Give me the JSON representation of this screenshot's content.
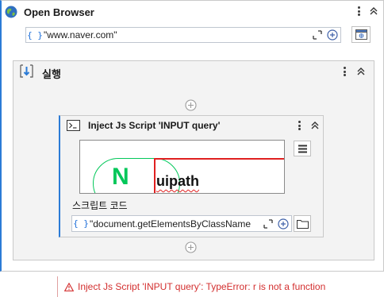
{
  "outer": {
    "title": "Open Browser",
    "url_value": "\"www.naver.com\""
  },
  "sequence": {
    "title": "실행"
  },
  "inject": {
    "title": "Inject Js Script 'INPUT  query'",
    "script_label": "스크립트 코드",
    "script_value": "\"document.getElementsByClassName",
    "preview_text": "uipath",
    "preview_logo": "N"
  },
  "error": {
    "message": "Inject Js Script 'INPUT  query': TypeError: r is not a function"
  },
  "colors": {
    "accent": "#2b7bd6",
    "error": "#d32f2f",
    "naver_green": "#03c75a",
    "highlight": "#e02020"
  }
}
